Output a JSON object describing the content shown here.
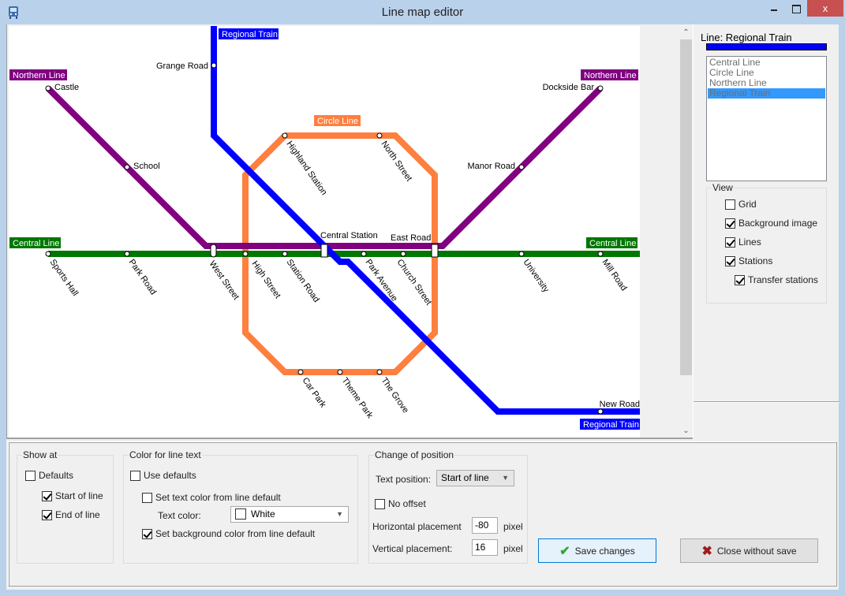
{
  "window": {
    "title": "Line map editor",
    "close_glyph": "x"
  },
  "map": {
    "lines": [
      {
        "name": "Central Line",
        "color": "#007700",
        "label_text_color": "#ffffff"
      },
      {
        "name": "Circle Line",
        "color": "#ff7f3f",
        "label_text_color": "#ffffff"
      },
      {
        "name": "Northern Line",
        "color": "#800080",
        "label_text_color": "#ffffff"
      },
      {
        "name": "Regional Train",
        "color": "#0000ff",
        "label_text_color": "#ffffff"
      }
    ],
    "line_labels": [
      {
        "text": "Regional Train",
        "line": "Regional Train"
      },
      {
        "text": "Northern Line",
        "line": "Northern Line"
      },
      {
        "text": "Northern Line",
        "line": "Northern Line"
      },
      {
        "text": "Circle Line",
        "line": "Circle Line"
      },
      {
        "text": "Central Line",
        "line": "Central Line"
      },
      {
        "text": "Central Line",
        "line": "Central Line"
      },
      {
        "text": "Regional Train",
        "line": "Regional Train"
      }
    ],
    "stations": {
      "grange_road": "Grange Road",
      "castle": "Castle",
      "school": "School",
      "dockside_bar": "Dockside Bar",
      "manor_road": "Manor Road",
      "highland_station": "Highland Station",
      "north_street": "North Street",
      "central_station": "Central Station",
      "east_road": "East Road",
      "sports_hall": "Sports Hall",
      "park_road": "Park Road",
      "west_street": "West Street",
      "high_street": "High Street",
      "station_road": "Station Road",
      "park_avenue": "Park Avenue",
      "church_street": "Church Street",
      "university": "University",
      "mill_road": "Mill Road",
      "car_park": "Car Park",
      "theme_park": "Theme Park",
      "the_grove": "The Grove",
      "new_road": "New Road"
    }
  },
  "right_panel": {
    "selected_line_title": "Line: Regional Train",
    "selected_line_color": "#0000ff",
    "line_list": [
      "Central Line",
      "Circle Line",
      "Northern Line",
      "Regional Train"
    ],
    "selected_index": 3,
    "view_group": {
      "label": "View",
      "options": [
        {
          "label": "Grid",
          "checked": false
        },
        {
          "label": "Background image",
          "checked": true
        },
        {
          "label": "Lines",
          "checked": true
        },
        {
          "label": "Stations",
          "checked": true
        },
        {
          "label": "Transfer stations",
          "checked": true
        }
      ]
    }
  },
  "bottom": {
    "show_at": {
      "label": "Show at",
      "defaults": {
        "label": "Defaults",
        "checked": false
      },
      "start_of_line": {
        "label": "Start of line",
        "checked": true
      },
      "end_of_line": {
        "label": "End of line",
        "checked": true
      }
    },
    "color_for_line_text": {
      "label": "Color for line text",
      "use_defaults": {
        "label": "Use defaults",
        "checked": false
      },
      "set_text_color": {
        "label": "Set text color from line default",
        "checked": false
      },
      "text_color_label": "Text color:",
      "text_color_value": "White",
      "set_bg_color": {
        "label": "Set background color from line default",
        "checked": true
      }
    },
    "change_of_position": {
      "label": "Change of position",
      "text_position_label": "Text position:",
      "text_position_value": "Start of line",
      "no_offset": {
        "label": "No offset",
        "checked": false
      },
      "horizontal_label": "Horizontal placement",
      "horizontal_value": "-80",
      "vertical_label": "Vertical placement:",
      "vertical_value": "16",
      "unit": "pixel"
    },
    "save_button": "Save changes",
    "close_button": "Close without save"
  }
}
